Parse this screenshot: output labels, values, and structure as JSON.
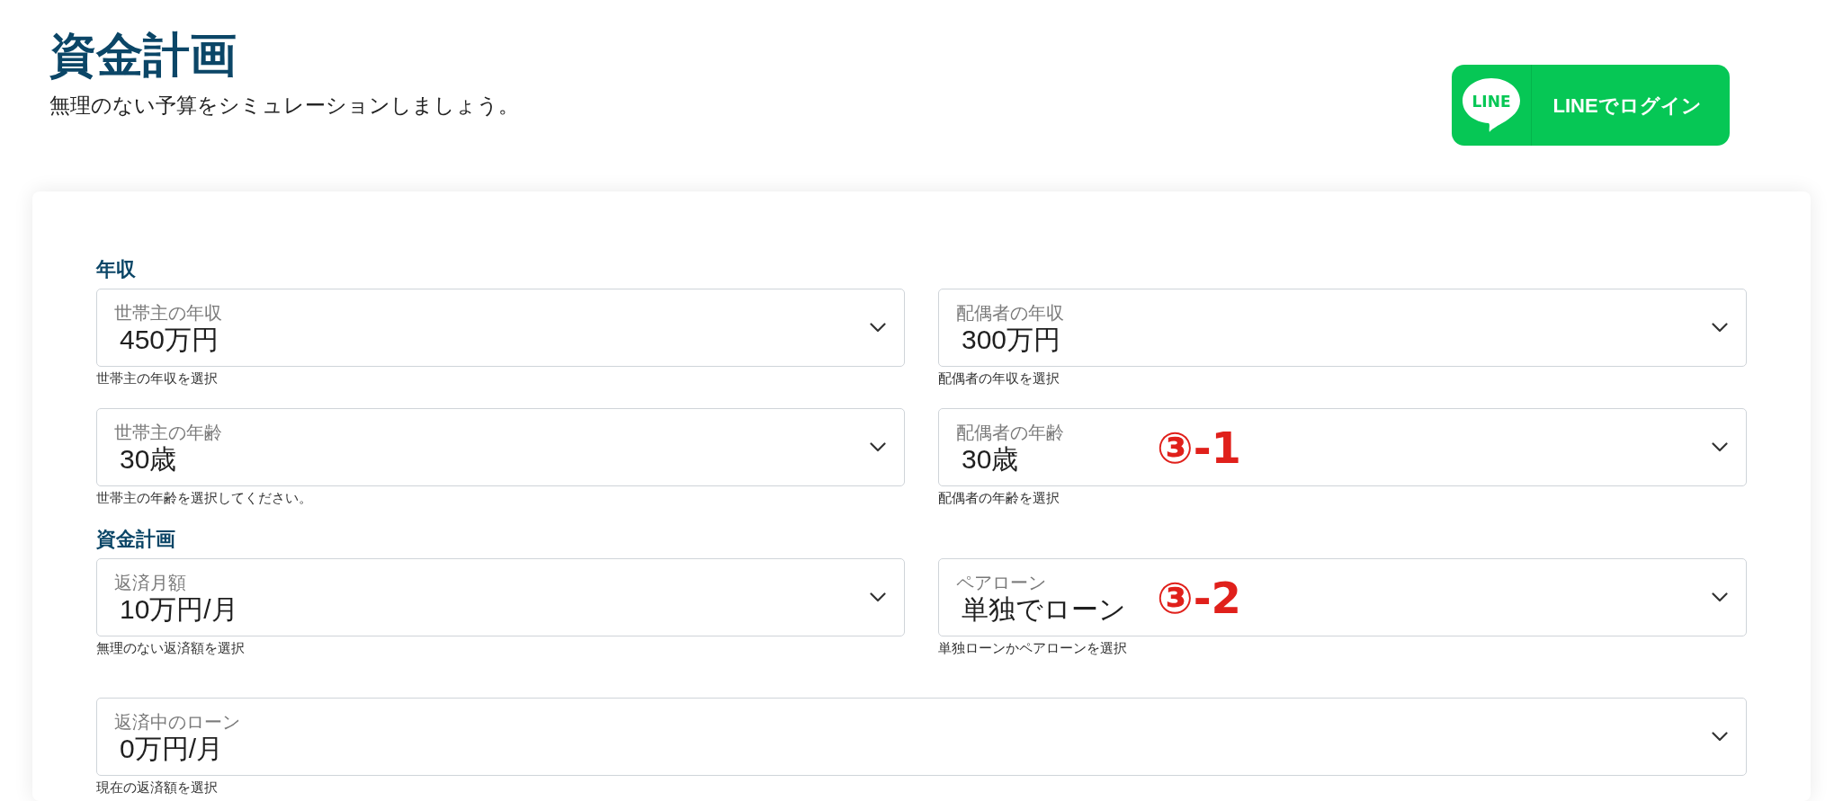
{
  "header": {
    "title": "資金計画",
    "subtitle": "無理のない予算をシミュレーションしましょう。"
  },
  "login_button": {
    "logo_text": "LINE",
    "label": "LINEでログイン"
  },
  "sections": [
    {
      "heading": "年収",
      "fields": [
        {
          "label": "世帯主の年収",
          "value": "450万円",
          "helper": "世帯主の年収を選択",
          "wide": false
        },
        {
          "label": "配偶者の年収",
          "value": "300万円",
          "helper": "配偶者の年収を選択",
          "wide": false
        },
        {
          "label": "世帯主の年齢",
          "value": "30歳",
          "helper": "世帯主の年齢を選択してください。",
          "wide": false
        },
        {
          "label": "配偶者の年齢",
          "value": "30歳",
          "helper": "配偶者の年齢を選択",
          "wide": false,
          "annotation": "③-1"
        }
      ]
    },
    {
      "heading": "資金計画",
      "fields": [
        {
          "label": "返済月額",
          "value": "10万円/月",
          "helper": "無理のない返済額を選択",
          "wide": false
        },
        {
          "label": "ペアローン",
          "value": "単独でローン",
          "helper": "単独ローンかペアローンを選択",
          "wide": false,
          "annotation": "③-2"
        },
        {
          "label": "返済中のローン",
          "value": "0万円/月",
          "helper": "現在の返済額を選択",
          "wide": true
        }
      ]
    }
  ]
}
